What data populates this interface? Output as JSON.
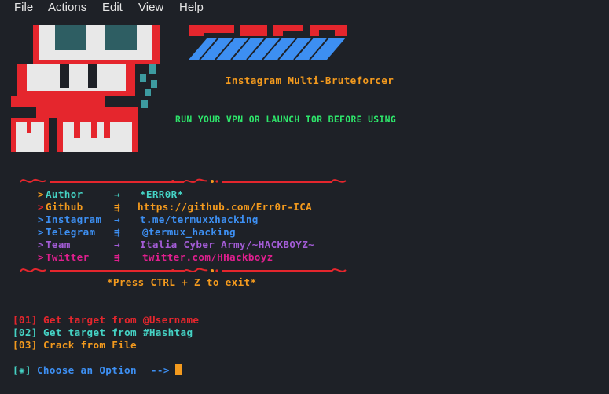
{
  "menu": {
    "file": "File",
    "actions": "Actions",
    "edit": "Edit",
    "view": "View",
    "help": "Help"
  },
  "terminal": {
    "subtitle": "Instagram Multi-Bruteforcer",
    "warning": "RUN YOUR VPN OR LAUNCH TOR BEFORE USING",
    "info": [
      {
        "bullet": ">",
        "label": "Author",
        "arrow": "→",
        "value": "*ERR0R*"
      },
      {
        "bullet": ">",
        "label": "Github",
        "arrow": "⇶",
        "value": "https://github.com/Err0r-ICA"
      },
      {
        "bullet": ">",
        "label": "Instagram",
        "arrow": "→",
        "value": "t.me/termuxxhacking"
      },
      {
        "bullet": ">",
        "label": "Telegram",
        "arrow": "⇶",
        "value": "@termux_hacking"
      },
      {
        "bullet": ">",
        "label": "Team",
        "arrow": "→",
        "value": "Italia Cyber Army/~HACKBOYZ~"
      },
      {
        "bullet": ">",
        "label": "Twitter",
        "arrow": "⇶",
        "value": "twitter.com/HHackboyz"
      }
    ],
    "exit_hint": "*Press CTRL + Z to exit*",
    "options": [
      {
        "num": "[01]",
        "text": "Get target from @Username"
      },
      {
        "num": "[02]",
        "text": "Get target from #Hashtag"
      },
      {
        "num": "[03]",
        "text": "Crack from File"
      }
    ],
    "prompt": {
      "bracket": "[✺]",
      "text": "Choose an Option",
      "arrow": "-->"
    }
  },
  "colors": {
    "background": "#1e2127",
    "menu_text": "#e6e6e6",
    "red": "#e5262d",
    "orange": "#f39a1e",
    "green": "#2ee66b",
    "cyan": "#45d3c5",
    "blue": "#3d8ff2",
    "purple": "#a35cd6",
    "magenta": "#e01f8e",
    "cursor": "#f39a1e"
  },
  "icons": {
    "skull_art": "skull-ascii-art",
    "logo_art": "logo-ascii-art",
    "divider_ornament": "ornament-divider"
  }
}
